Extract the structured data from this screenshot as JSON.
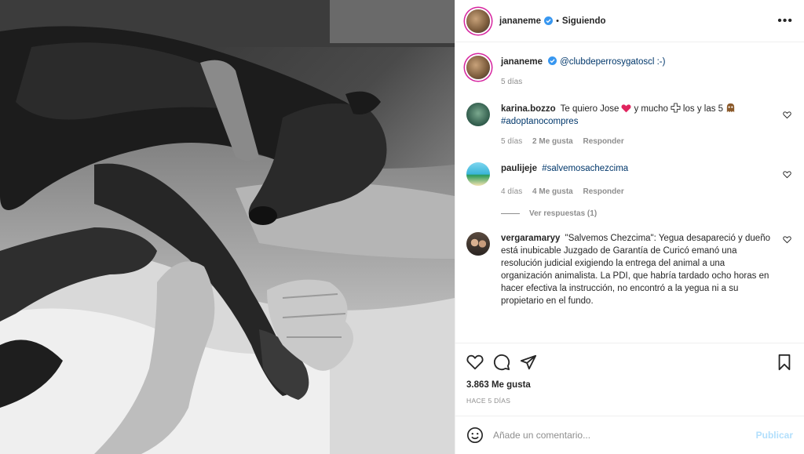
{
  "header": {
    "username": "jananeme",
    "separator": "•",
    "follow_state": "Siguiendo",
    "more_label": "•••"
  },
  "caption": {
    "username": "jananeme",
    "text": "@clubdeperrosygatoscl :-)",
    "time": "5 días"
  },
  "comments": [
    {
      "username": "karina.bozzo",
      "text_a": "Te quiero Jose",
      "text_b": "y mucho",
      "text_c": "los y las 5",
      "hashtag": "#adoptanocompres",
      "time": "5 días",
      "likes": "2 Me gusta",
      "reply": "Responder"
    },
    {
      "username": "paulijeje",
      "hashtag": "#salvemosachezcima",
      "time": "4 días",
      "likes": "4 Me gusta",
      "reply": "Responder",
      "view_replies": "Ver respuestas (1)"
    },
    {
      "username": "vergaramaryy",
      "text": "\"Salvemos Chezcima\": Yegua desapareció y dueño está inubicable Juzgado de Garantía de Curicó emanó una resolución judicial exigiendo la entrega del animal a una organización animalista. La PDI, que habría tardado ocho horas en hacer efectiva la instrucción, no encontró a la yegua ni a su propietario en el fundo."
    }
  ],
  "actions": {
    "likes_count": "3.863 Me gusta",
    "posted_ago": "HACE 5 DÍAS"
  },
  "add_comment": {
    "placeholder": "Añade un comentario...",
    "post_label": "Publicar"
  },
  "colors": {
    "verified": "#3897f0",
    "link": "#00376b",
    "muted": "#8e8e8e",
    "publish_disabled": "#b2dffc",
    "heart_red": "#e0245e"
  },
  "icons": [
    "verified-icon",
    "more-icon",
    "heart-icon",
    "comment-icon",
    "share-icon",
    "save-icon",
    "emoji-icon"
  ]
}
